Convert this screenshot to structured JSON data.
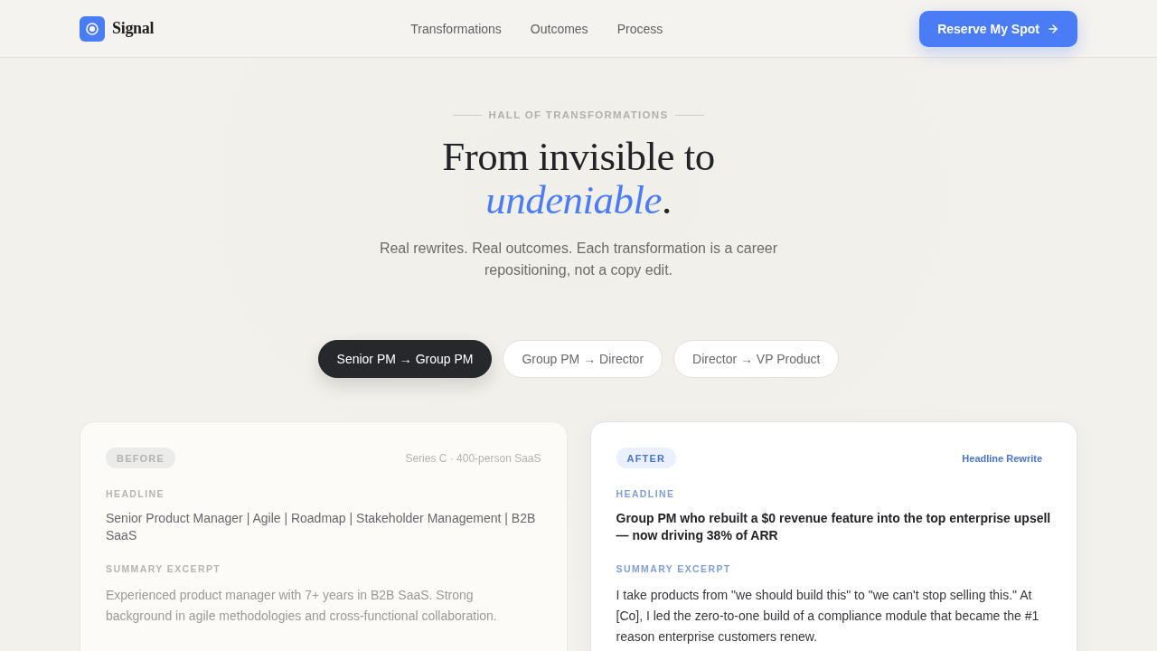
{
  "nav": {
    "brand": "Signal",
    "links": [
      "Transformations",
      "Outcomes",
      "Process"
    ],
    "cta": "Reserve My Spot"
  },
  "hero": {
    "eyebrow": "HALL OF TRANSFORMATIONS",
    "title": "From invisible to",
    "title_accent": "undeniable",
    "title_end": ".",
    "subtitle": "Real rewrites. Real outcomes. Each transformation is a career repositioning, not a copy edit."
  },
  "tabs": [
    {
      "label": "Senior PM → Group PM",
      "selected": true
    },
    {
      "label": "Group PM → Director",
      "selected": false
    },
    {
      "label": "Director → VP Product",
      "selected": false
    }
  ],
  "comparison": [
    {
      "kind": "before",
      "badge": "BEFORE",
      "meta": "Series C · 400-person SaaS",
      "sections": [
        {
          "label": "HEADLINE",
          "text": "Senior Product Manager | Agile | Roadmap | Stakeholder Management | B2B SaaS"
        },
        {
          "label": "SUMMARY EXCERPT",
          "text": "Experienced product manager with 7+ years in B2B SaaS. Strong background in agile methodologies and cross-functional collaboration."
        }
      ]
    },
    {
      "kind": "after",
      "badge": "AFTER",
      "meta": "Headline Rewrite",
      "sections": [
        {
          "label": "HEADLINE",
          "text": "Group PM who rebuilt a $0 revenue feature into the top enterprise upsell — now driving 38% of ARR"
        },
        {
          "label": "SUMMARY EXCERPT",
          "text": "I take products from \"we should build this\" to \"we can't stop selling this.\" At [Co], I led the zero-to-one build of a compliance module that became the #1 reason enterprise customers renew."
        }
      ]
    }
  ]
}
